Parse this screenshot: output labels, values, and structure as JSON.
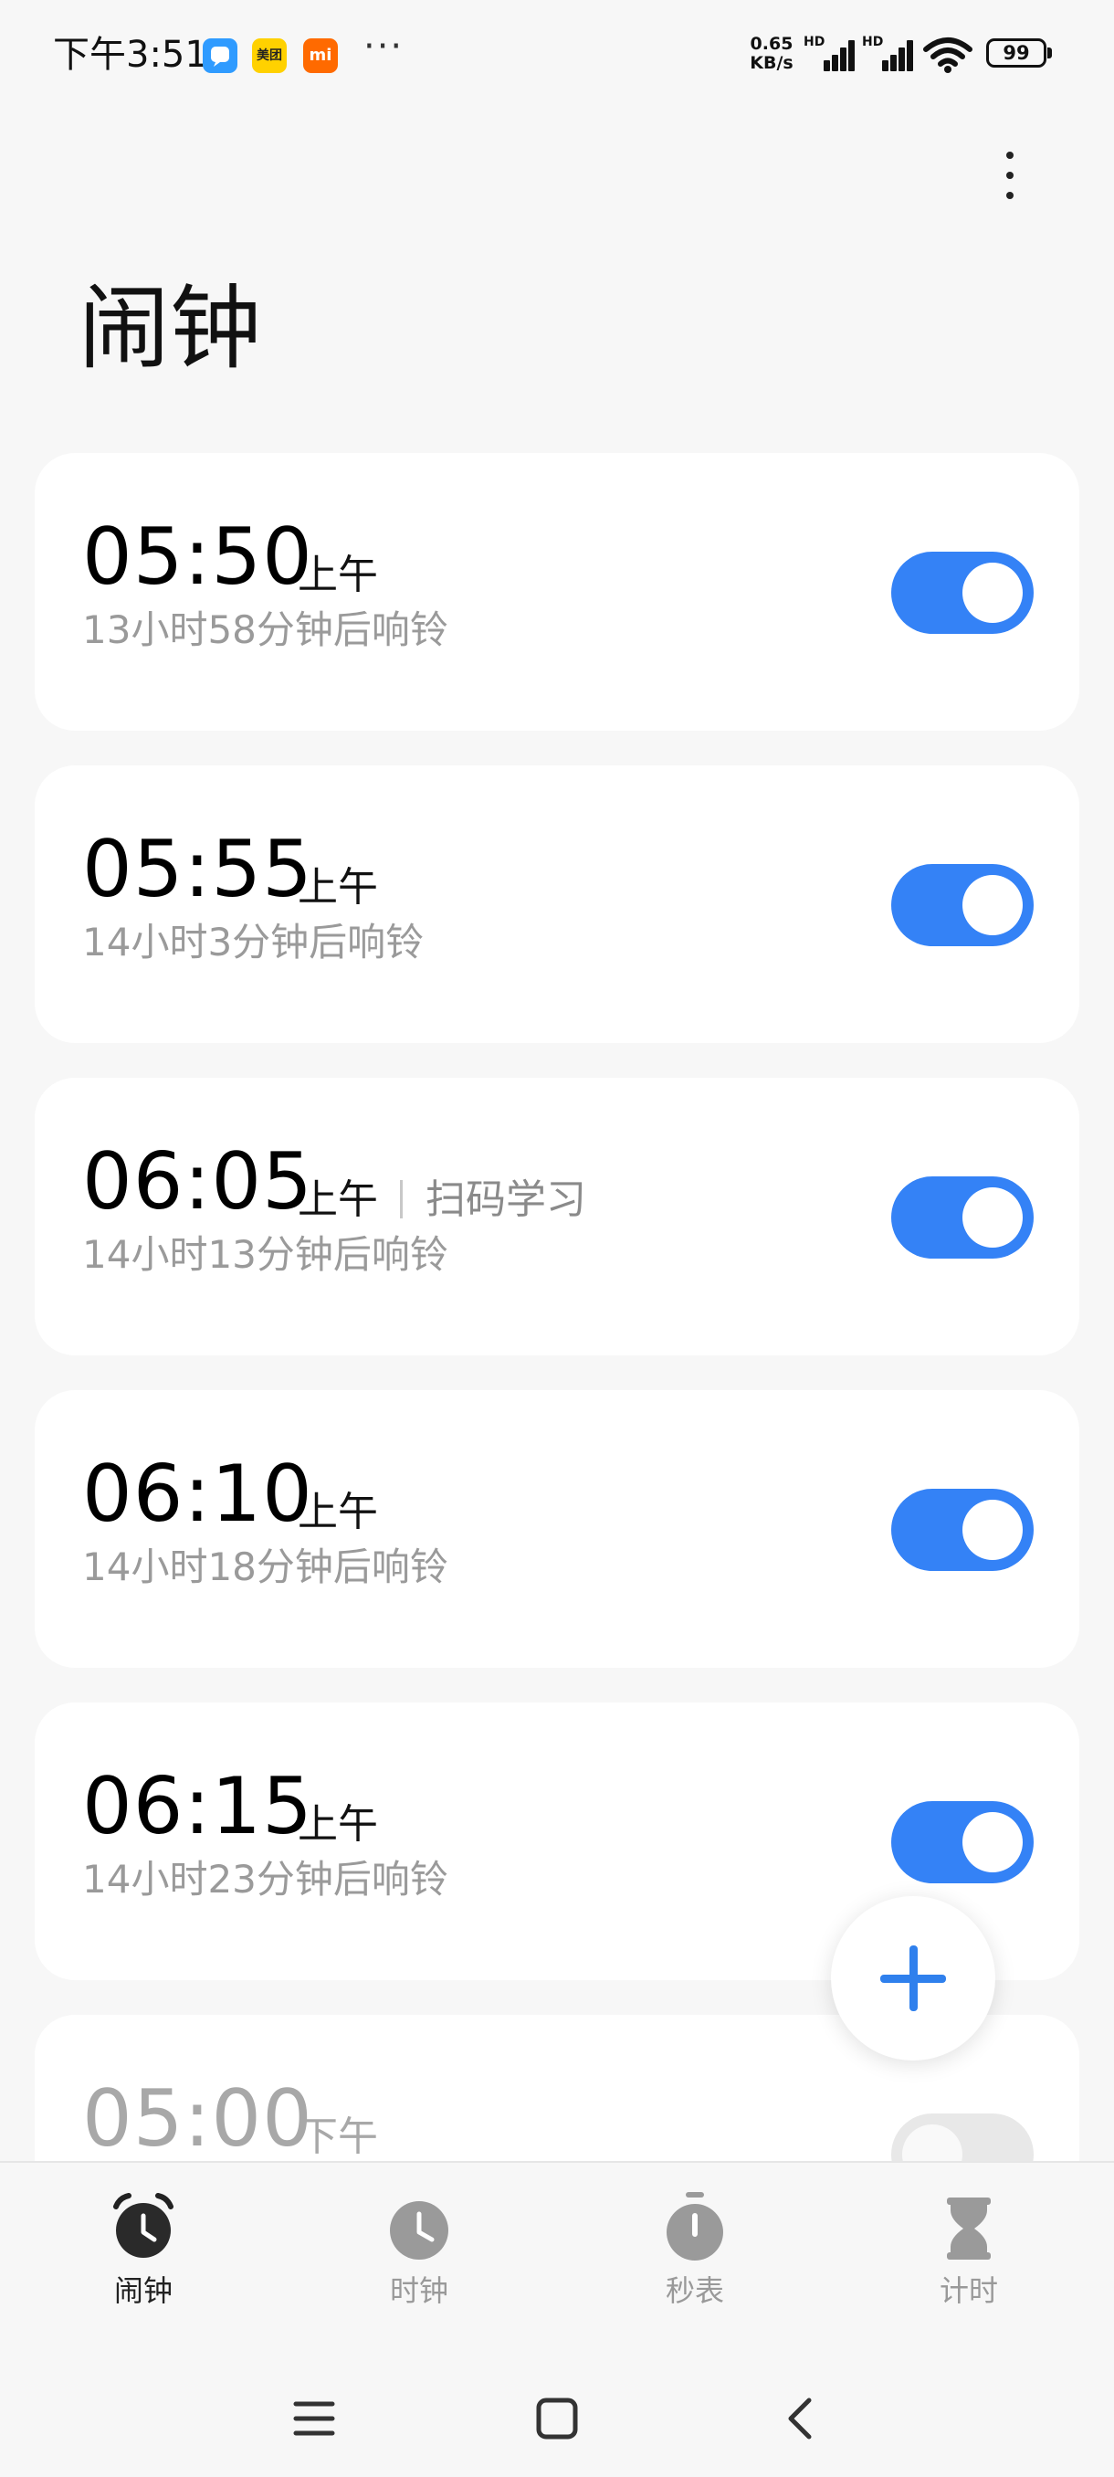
{
  "status_bar": {
    "time": "下午3:51",
    "apps": [
      {
        "name": "message-app-icon",
        "text": "",
        "color": "#2f9bff"
      },
      {
        "name": "meituan-app-icon",
        "text": "美团",
        "color": "#ffd100"
      },
      {
        "name": "mi-app-icon",
        "text": "mi",
        "color": "#ff6a00"
      }
    ],
    "overflow": "···",
    "net_speed_value": "0.65",
    "net_speed_unit": "KB/s",
    "signal_1_label": "HD",
    "signal_2_label": "HD",
    "battery": "99"
  },
  "header": {
    "title": "闹钟"
  },
  "alarms": [
    {
      "time": "05:50",
      "ampm": "上午",
      "label": "",
      "subtitle": "13小时58分钟后响铃",
      "enabled": true
    },
    {
      "time": "05:55",
      "ampm": "上午",
      "label": "",
      "subtitle": "14小时3分钟后响铃",
      "enabled": true
    },
    {
      "time": "06:05",
      "ampm": "上午",
      "label": "扫码学习",
      "subtitle": "14小时13分钟后响铃",
      "enabled": true
    },
    {
      "time": "06:10",
      "ampm": "上午",
      "label": "",
      "subtitle": "14小时18分钟后响铃",
      "enabled": true
    },
    {
      "time": "06:15",
      "ampm": "上午",
      "label": "",
      "subtitle": "14小时23分钟后响铃",
      "enabled": true
    },
    {
      "time": "05:00",
      "ampm": "下午",
      "label": "",
      "subtitle": "",
      "enabled": false
    }
  ],
  "bottom_nav": {
    "items": [
      {
        "label": "闹钟",
        "icon": "alarm-clock-icon",
        "active": true
      },
      {
        "label": "时钟",
        "icon": "clock-icon",
        "active": false
      },
      {
        "label": "秒表",
        "icon": "stopwatch-icon",
        "active": false
      },
      {
        "label": "计时",
        "icon": "hourglass-icon",
        "active": false
      }
    ]
  },
  "colors": {
    "accent": "#3482f6",
    "background": "#f7f7f7",
    "card": "#ffffff",
    "toggle_off": "#e8e8e8"
  }
}
